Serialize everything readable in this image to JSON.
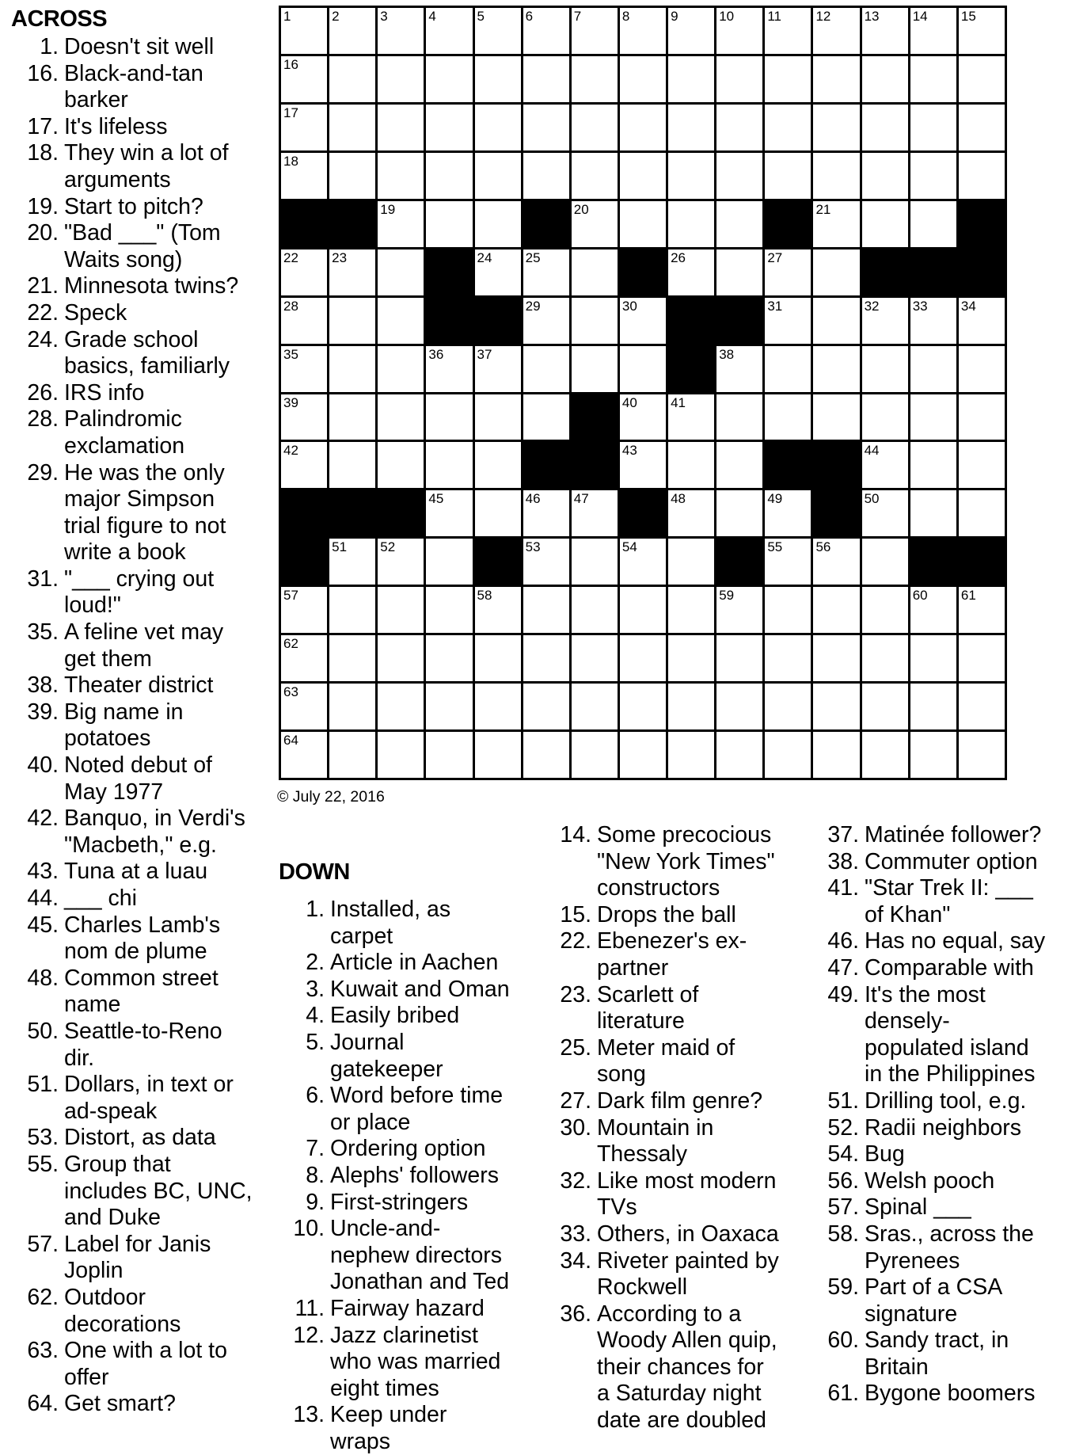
{
  "across_header": "ACROSS",
  "down_header": "DOWN",
  "copyright": "© July 22, 2016",
  "grid": {
    "rows": [
      "...............",
      "...............",
      "...............",
      "...............",
      "##...#....#...#",
      "...#...#....###",
      "...##...##.....",
      "........#......",
      "......#........",
      ".....##...##...",
      "###....#...#...",
      "#...#....#...##",
      "...............",
      "...............",
      "...............",
      "..............."
    ],
    "numbers": [
      [
        1,
        2,
        3,
        4,
        5,
        6,
        7,
        8,
        9,
        10,
        11,
        12,
        13,
        14,
        15
      ],
      [
        16,
        0,
        0,
        0,
        0,
        0,
        0,
        0,
        0,
        0,
        0,
        0,
        0,
        0,
        0
      ],
      [
        17,
        0,
        0,
        0,
        0,
        0,
        0,
        0,
        0,
        0,
        0,
        0,
        0,
        0,
        0
      ],
      [
        18,
        0,
        0,
        0,
        0,
        0,
        0,
        0,
        0,
        0,
        0,
        0,
        0,
        0,
        0
      ],
      [
        0,
        0,
        19,
        0,
        0,
        0,
        20,
        0,
        0,
        0,
        0,
        21,
        0,
        0,
        0
      ],
      [
        22,
        23,
        0,
        0,
        24,
        25,
        0,
        0,
        26,
        0,
        27,
        0,
        0,
        0,
        0
      ],
      [
        28,
        0,
        0,
        0,
        0,
        29,
        0,
        30,
        0,
        0,
        31,
        0,
        32,
        33,
        34
      ],
      [
        35,
        0,
        0,
        36,
        37,
        0,
        0,
        0,
        0,
        38,
        0,
        0,
        0,
        0,
        0
      ],
      [
        39,
        0,
        0,
        0,
        0,
        0,
        0,
        40,
        41,
        0,
        0,
        0,
        0,
        0,
        0
      ],
      [
        42,
        0,
        0,
        0,
        0,
        0,
        0,
        43,
        0,
        0,
        0,
        0,
        44,
        0,
        0
      ],
      [
        0,
        0,
        0,
        45,
        0,
        46,
        47,
        0,
        48,
        0,
        49,
        0,
        50,
        0,
        0
      ],
      [
        0,
        51,
        52,
        0,
        0,
        53,
        0,
        54,
        0,
        0,
        55,
        56,
        0,
        0,
        0
      ],
      [
        57,
        0,
        0,
        0,
        58,
        0,
        0,
        0,
        0,
        59,
        0,
        0,
        0,
        60,
        61
      ],
      [
        62,
        0,
        0,
        0,
        0,
        0,
        0,
        0,
        0,
        0,
        0,
        0,
        0,
        0,
        0
      ],
      [
        63,
        0,
        0,
        0,
        0,
        0,
        0,
        0,
        0,
        0,
        0,
        0,
        0,
        0,
        0
      ],
      [
        64,
        0,
        0,
        0,
        0,
        0,
        0,
        0,
        0,
        0,
        0,
        0,
        0,
        0,
        0
      ]
    ]
  },
  "across": [
    {
      "num": "1.",
      "text": "Doesn't sit well"
    },
    {
      "num": "16.",
      "text": "Black-and-tan\nbarker"
    },
    {
      "num": "17.",
      "text": "It's lifeless"
    },
    {
      "num": "18.",
      "text": "They win a lot of\narguments"
    },
    {
      "num": "19.",
      "text": "Start to pitch?"
    },
    {
      "num": "20.",
      "text": "\"Bad ___\" (Tom\nWaits song)"
    },
    {
      "num": "21.",
      "text": "Minnesota twins?"
    },
    {
      "num": "22.",
      "text": "Speck"
    },
    {
      "num": "24.",
      "text": "Grade school\nbasics, familiarly"
    },
    {
      "num": "26.",
      "text": "IRS info"
    },
    {
      "num": "28.",
      "text": "Palindromic\nexclamation"
    },
    {
      "num": "29.",
      "text": "He was the only\nmajor Simpson\ntrial figure to not\nwrite a book"
    },
    {
      "num": "31.",
      "text": "\"___ crying out\nloud!\""
    },
    {
      "num": "35.",
      "text": "A feline vet may\nget them"
    },
    {
      "num": "38.",
      "text": "Theater district"
    },
    {
      "num": "39.",
      "text": "Big name in\npotatoes"
    },
    {
      "num": "40.",
      "text": "Noted debut of\nMay 1977"
    },
    {
      "num": "42.",
      "text": "Banquo, in Verdi's\n\"Macbeth,\" e.g."
    },
    {
      "num": "43.",
      "text": "Tuna at a luau"
    },
    {
      "num": "44.",
      "text": "___ chi"
    },
    {
      "num": "45.",
      "text": "Charles Lamb's\nnom de plume"
    },
    {
      "num": "48.",
      "text": "Common street\nname"
    },
    {
      "num": "50.",
      "text": "Seattle-to-Reno\ndir."
    },
    {
      "num": "51.",
      "text": "Dollars, in text or\nad-speak"
    },
    {
      "num": "53.",
      "text": "Distort, as data"
    },
    {
      "num": "55.",
      "text": "Group that\nincludes BC, UNC,\nand Duke"
    },
    {
      "num": "57.",
      "text": "Label for Janis\nJoplin"
    },
    {
      "num": "62.",
      "text": "Outdoor\ndecorations"
    },
    {
      "num": "63.",
      "text": "One with a lot to\noffer"
    },
    {
      "num": "64.",
      "text": "Get smart?"
    }
  ],
  "down_col1": [
    {
      "num": "1.",
      "text": "Installed, as\ncarpet"
    },
    {
      "num": "2.",
      "text": "Article in Aachen"
    },
    {
      "num": "3.",
      "text": "Kuwait and Oman"
    },
    {
      "num": "4.",
      "text": "Easily bribed"
    },
    {
      "num": "5.",
      "text": "Journal\ngatekeeper"
    },
    {
      "num": "6.",
      "text": "Word before time\nor place"
    },
    {
      "num": "7.",
      "text": "Ordering option"
    },
    {
      "num": "8.",
      "text": "Alephs' followers"
    },
    {
      "num": "9.",
      "text": "First-stringers"
    },
    {
      "num": "10.",
      "text": "Uncle-and-\nnephew directors\nJonathan and Ted"
    },
    {
      "num": "11.",
      "text": "Fairway hazard"
    },
    {
      "num": "12.",
      "text": "Jazz clarinetist\nwho was married\neight times"
    },
    {
      "num": "13.",
      "text": "Keep under\nwraps"
    }
  ],
  "down_col2": [
    {
      "num": "14.",
      "text": "Some precocious\n\"New York Times\"\nconstructors"
    },
    {
      "num": "15.",
      "text": "Drops the ball"
    },
    {
      "num": "22.",
      "text": "Ebenezer's ex-\npartner"
    },
    {
      "num": "23.",
      "text": "Scarlett of\nliterature"
    },
    {
      "num": "25.",
      "text": "Meter maid of\nsong"
    },
    {
      "num": "27.",
      "text": "Dark film genre?"
    },
    {
      "num": "30.",
      "text": "Mountain in\nThessaly"
    },
    {
      "num": "32.",
      "text": "Like most modern\nTVs"
    },
    {
      "num": "33.",
      "text": "Others, in Oaxaca"
    },
    {
      "num": "34.",
      "text": "Riveter painted by\nRockwell"
    },
    {
      "num": "36.",
      "text": "According to a\nWoody Allen quip,\ntheir chances for\na Saturday night\ndate are doubled"
    }
  ],
  "down_col3": [
    {
      "num": "37.",
      "text": "Matinée follower?"
    },
    {
      "num": "38.",
      "text": "Commuter option"
    },
    {
      "num": "41.",
      "text": "\"Star Trek II: ___\nof Khan\""
    },
    {
      "num": "46.",
      "text": "Has no equal, say"
    },
    {
      "num": "47.",
      "text": "Comparable with"
    },
    {
      "num": "49.",
      "text": "It's the most\ndensely-\npopulated island\nin the Philippines"
    },
    {
      "num": "51.",
      "text": "Drilling tool, e.g."
    },
    {
      "num": "52.",
      "text": "Radii neighbors"
    },
    {
      "num": "54.",
      "text": "Bug"
    },
    {
      "num": "56.",
      "text": "Welsh pooch"
    },
    {
      "num": "57.",
      "text": "Spinal ___"
    },
    {
      "num": "58.",
      "text": "Sras., across the\nPyrenees"
    },
    {
      "num": "59.",
      "text": "Part of a CSA\nsignature"
    },
    {
      "num": "60.",
      "text": "Sandy tract, in\nBritain"
    },
    {
      "num": "61.",
      "text": "Bygone boomers"
    }
  ]
}
